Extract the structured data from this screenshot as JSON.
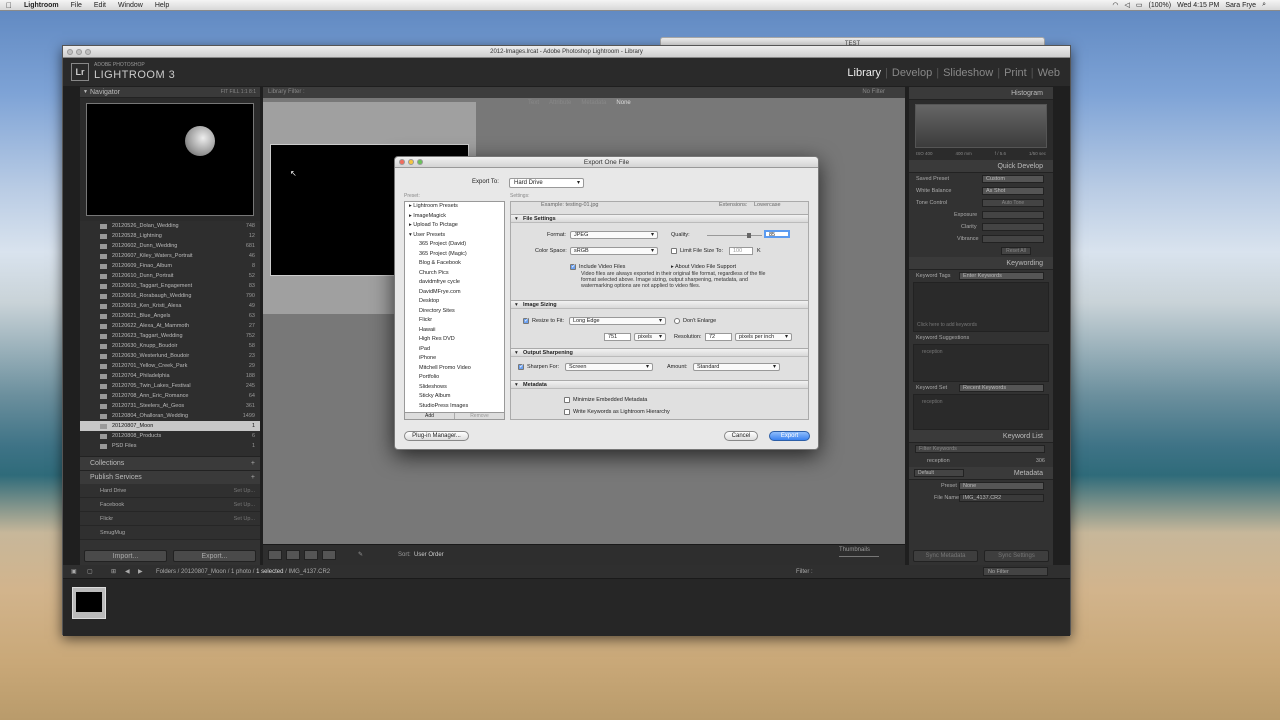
{
  "menubar": {
    "apple": "",
    "items": [
      "Lightroom",
      "File",
      "Edit",
      "Window",
      "Help"
    ],
    "battery": "(100%)",
    "clock": "Wed 4:15 PM",
    "user": "Sara Frye"
  },
  "bg_window": {
    "title": "TEST"
  },
  "window": {
    "title": "2012-Images.lrcat - Adobe Photoshop Lightroom - Library",
    "logo": "Lr",
    "brand_small": "ADOBE PHOTOSHOP",
    "brand_big": "LIGHTROOM 3",
    "modules": [
      "Library",
      "Develop",
      "Slideshow",
      "Print",
      "Web"
    ]
  },
  "navigator": {
    "label": "Navigator",
    "tools": "FIT  FILL  1:1  8:1"
  },
  "folders": [
    {
      "name": "20120526_Dolan_Wedding",
      "count": "748"
    },
    {
      "name": "20120528_Lightning",
      "count": "12"
    },
    {
      "name": "20120602_Dunn_Wedding",
      "count": "681"
    },
    {
      "name": "20120607_Kiley_Waters_Portrait",
      "count": "46"
    },
    {
      "name": "20120609_Finao_Album",
      "count": "8"
    },
    {
      "name": "20120610_Dunn_Portrait",
      "count": "52"
    },
    {
      "name": "20120610_Taggart_Engagement",
      "count": "83"
    },
    {
      "name": "20120616_Rorabaugh_Wedding",
      "count": "790"
    },
    {
      "name": "20120619_Ken_Kristi_Alexa",
      "count": "49"
    },
    {
      "name": "20120621_Blue_Angels",
      "count": "63"
    },
    {
      "name": "20120622_Alexa_At_Mammoth",
      "count": "27"
    },
    {
      "name": "20120623_Taggart_Wedding",
      "count": "752"
    },
    {
      "name": "20120630_Knupp_Boudoir",
      "count": "58"
    },
    {
      "name": "20120630_Westerlund_Boudoir",
      "count": "23"
    },
    {
      "name": "20120701_Yellow_Creek_Park",
      "count": "29"
    },
    {
      "name": "20120704_Philadelphia",
      "count": "188"
    },
    {
      "name": "20120705_Twin_Lakes_Festival",
      "count": "245"
    },
    {
      "name": "20120708_Ann_Eric_Romance",
      "count": "64"
    },
    {
      "name": "20120731_Steelers_At_Geos",
      "count": "361"
    },
    {
      "name": "20120804_Ohalloran_Wedding",
      "count": "1499"
    },
    {
      "name": "20120807_Moon",
      "count": "1"
    },
    {
      "name": "20120808_Products",
      "count": "6"
    },
    {
      "name": "PSD Files",
      "count": "1"
    }
  ],
  "collections_label": "Collections",
  "publish": {
    "label": "Publish Services",
    "services": [
      {
        "name": "Hard Drive",
        "setup": "Set Up..."
      },
      {
        "name": "Facebook",
        "setup": "Set Up..."
      },
      {
        "name": "Flickr",
        "setup": "Set Up..."
      },
      {
        "name": "SmugMug",
        "setup": ""
      }
    ]
  },
  "left_buttons": {
    "import": "Import...",
    "export": "Export..."
  },
  "library_filter": {
    "label": "Library Filter :",
    "options": [
      "Text",
      "Attribute",
      "Metadata",
      "None"
    ],
    "preset": "No Filter"
  },
  "toolbar": {
    "sort_label": "Sort:",
    "sort_value": "User Order",
    "thumbnails": "Thumbnails"
  },
  "right_panel": {
    "histogram": "Histogram",
    "hist_info": [
      "ISO 400",
      "400 mm",
      "f / 5.6",
      "1/50 sec"
    ],
    "quick_develop": "Quick Develop",
    "saved_preset": {
      "label": "Saved Preset",
      "value": "Custom"
    },
    "white_balance": {
      "label": "White Balance",
      "value": "As Shot"
    },
    "tone_control": {
      "label": "Tone Control",
      "button": "Auto Tone"
    },
    "tone_rows": [
      "Exposure",
      "Clarity",
      "Vibrance"
    ],
    "reset": "Reset All",
    "keywording": "Keywording",
    "keyword_tags": {
      "label": "Keyword Tags",
      "value": "Enter Keywords"
    },
    "kw_hint": "Click here to add keywords",
    "kw_suggestions": "Keyword Suggestions",
    "kw_suggest_item": "reception",
    "keyword_set": {
      "label": "Keyword Set",
      "value": "Recent Keywords"
    },
    "kw_set_item": "reception",
    "keyword_list": "Keyword List",
    "kw_filter": "Filter Keywords",
    "kw_list_item": {
      "name": "reception",
      "count": "306"
    },
    "metadata": "Metadata",
    "meta_preset_default": "Default",
    "preset": {
      "label": "Preset",
      "value": "None"
    },
    "filename": {
      "label": "File Name",
      "value": "IMG_4137.CR2"
    },
    "sync_meta": "Sync Metadata",
    "sync_settings": "Sync Settings"
  },
  "filmstrip": {
    "path_prefix": "Folders / 20120807_Moon / 1 photo /",
    "path_selected": "1 selected",
    "path_file": "/ IMG_4137.CR2",
    "filter_label": "Filter :",
    "filter_value": "No Filter"
  },
  "dialog": {
    "title": "Export One File",
    "export_to_label": "Export To:",
    "export_to_value": "Hard Drive",
    "preset_label": "Preset:",
    "settings_label": "Settings:",
    "presets": [
      {
        "name": "Lightroom Presets",
        "top": true
      },
      {
        "name": "ImageMagick",
        "top": true
      },
      {
        "name": "Upload To Pictage",
        "top": true
      },
      {
        "name": "User Presets",
        "top": true
      },
      {
        "name": "365 Project (David)"
      },
      {
        "name": "365 Project (Magic)"
      },
      {
        "name": "Blog & Facebook"
      },
      {
        "name": "Church Pics"
      },
      {
        "name": "davidmfrye cycle"
      },
      {
        "name": "DavidMFrye.com"
      },
      {
        "name": "Desktop"
      },
      {
        "name": "Directory Sites"
      },
      {
        "name": "Flickr"
      },
      {
        "name": "Hawaii"
      },
      {
        "name": "High Res DVD"
      },
      {
        "name": "iPad"
      },
      {
        "name": "iPhone"
      },
      {
        "name": "Mitchell Promo Video"
      },
      {
        "name": "Portfolio"
      },
      {
        "name": "Slideshows"
      },
      {
        "name": "Sticky Album"
      },
      {
        "name": "StudioPress Images"
      }
    ],
    "add": "Add",
    "remove": "Remove",
    "example": "Example:  testing-01.jpg",
    "extensions_label": "Extensions:",
    "extensions_value": "Lowercase",
    "file_settings": "File Settings",
    "format_label": "Format:",
    "format_value": "JPEG",
    "quality_label": "Quality:",
    "quality_value": "85",
    "color_space_label": "Color Space:",
    "color_space_value": "sRGB",
    "limit_label": "Limit File Size To:",
    "limit_value": "100",
    "limit_unit": "K",
    "include_video": "Include Video Files",
    "about_video": "About Video File Support",
    "video_note": "Video files are always exported in their original file format, regardless of the file format selected above. Image sizing, output sharpening, metadata, and watermarking options are not applied to video files.",
    "image_sizing": "Image Sizing",
    "resize_label": "Resize to Fit:",
    "resize_value": "Long Edge",
    "dont_enlarge": "Don't Enlarge",
    "size_value": "751",
    "size_unit": "pixels",
    "resolution_label": "Resolution:",
    "resolution_value": "72",
    "resolution_unit": "pixels per inch",
    "output_sharpening": "Output Sharpening",
    "sharpen_label": "Sharpen For:",
    "sharpen_value": "Screen",
    "amount_label": "Amount:",
    "amount_value": "Standard",
    "metadata": "Metadata",
    "minimize_meta": "Minimize Embedded Metadata",
    "write_keywords": "Write Keywords as Lightroom Hierarchy",
    "plugin_manager": "Plug-in Manager...",
    "cancel": "Cancel",
    "export": "Export"
  }
}
